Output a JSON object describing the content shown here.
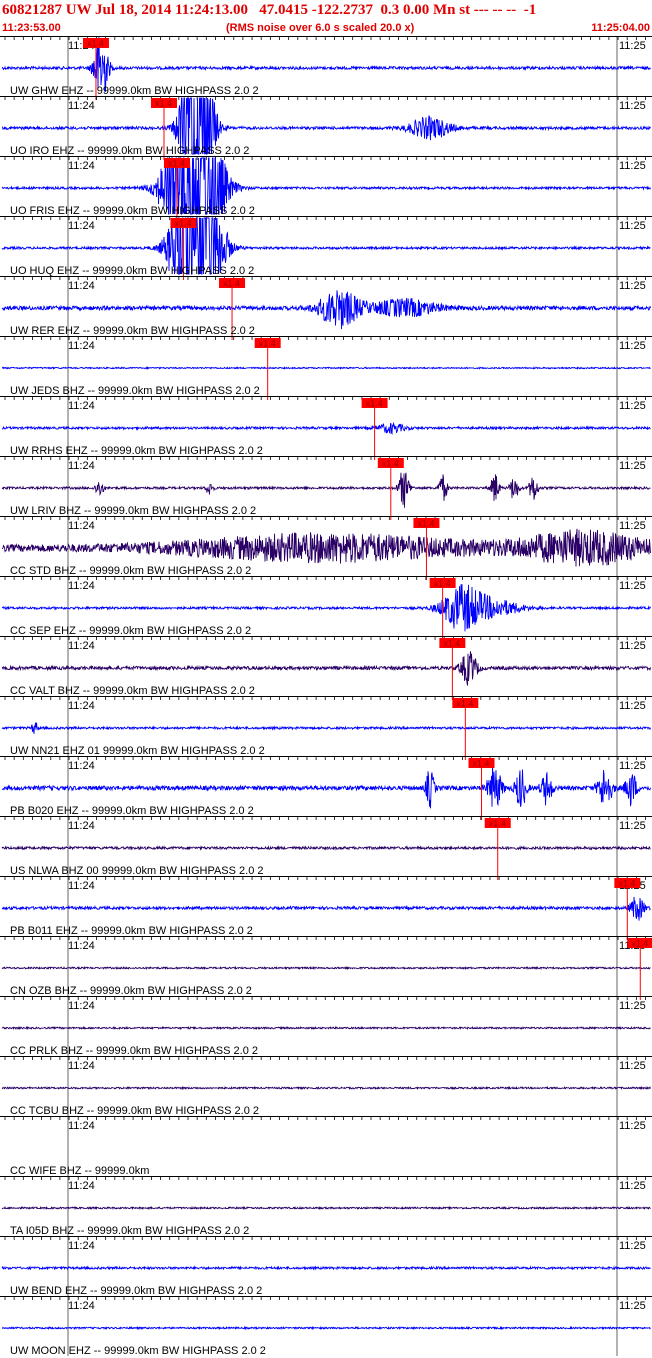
{
  "header": {
    "title": "60821287 UW Jul 18, 2014 11:24:13.00   47.0415 -122.2737  0.3 0.00 Mn st --- -- --  -1",
    "start_time": "11:23:53.00",
    "note": "(RMS noise over 6.0 s scaled 20.0 x)",
    "end_time": "11:25:04.00"
  },
  "colors": {
    "header_text": "#e00000",
    "trace_blue": "#0000ff",
    "trace_purple": "#2a0066",
    "pick": "#ff0000",
    "grid": "#000000"
  },
  "chart_data": {
    "type": "line",
    "title": "60821287 UW Jul 18, 2014 11:24:13.00   47.0415 -122.2737  0.3 0.00 Mn st --- -- --  -1",
    "x_tick_labels": [
      "11:24",
      "11:25"
    ],
    "pick_label": "x1.4",
    "traces": [
      {
        "label": "UW GHW EHZ -- 99999.0km BW  HIGHPASS  2.0  2",
        "color": "blue",
        "pick_time": 0.145,
        "bursts": [
          [
            0.152,
            0.01,
            3.0
          ]
        ],
        "noise": 0.1
      },
      {
        "label": "UO IRO EHZ -- 99999.0km BW  HIGHPASS  2.0  2",
        "color": "blue",
        "pick_time": 0.25,
        "bursts": [
          [
            0.3,
            0.02,
            12
          ],
          [
            0.66,
            0.03,
            0.8
          ]
        ],
        "noise": 0.1
      },
      {
        "label": "UO FRIS EHZ -- 99999.0km BW  HIGHPASS  2.0  2",
        "color": "blue",
        "pick_time": 0.27,
        "bursts": [
          [
            0.295,
            0.035,
            12
          ]
        ],
        "noise": 0.08
      },
      {
        "label": "UO HUQ EHZ -- 99999.0km BW  HIGHPASS  2.0  2",
        "color": "blue",
        "pick_time": 0.28,
        "bursts": [
          [
            0.3,
            0.03,
            12
          ]
        ],
        "noise": 0.08
      },
      {
        "label": "UW RER EHZ -- 99999.0km BW  HIGHPASS  2.0  2",
        "color": "blue",
        "pick_time": 0.355,
        "bursts": [
          [
            0.52,
            0.03,
            1.4
          ],
          [
            0.62,
            0.05,
            0.6
          ]
        ],
        "noise": 0.14
      },
      {
        "label": "UW JEDS BHZ -- 99999.0km BW  HIGHPASS  2.0  2",
        "color": "blue",
        "pick_time": 0.41,
        "bursts": [],
        "noise": 0.05
      },
      {
        "label": "UW RRHS EHZ -- 99999.0km BW  HIGHPASS  2.0  2",
        "color": "blue",
        "pick_time": 0.575,
        "bursts": [
          [
            0.6,
            0.02,
            0.35
          ]
        ],
        "noise": 0.08
      },
      {
        "label": "UW LRIV BHZ -- 99999.0km BW  HIGHPASS  2.0  2",
        "color": "purple",
        "pick_time": 0.6,
        "bursts": [
          [
            0.15,
            0.006,
            0.6
          ],
          [
            0.32,
            0.005,
            0.5
          ],
          [
            0.62,
            0.008,
            1.4
          ],
          [
            0.68,
            0.006,
            1.0
          ],
          [
            0.76,
            0.006,
            1.1
          ],
          [
            0.79,
            0.006,
            0.9
          ],
          [
            0.82,
            0.006,
            1.0
          ]
        ],
        "noise": 0.08
      },
      {
        "label": "CC STD BHZ -- 99999.0km BW  HIGHPASS  2.0  2",
        "color": "purple",
        "pick_time": 0.655,
        "bursts": [
          [
            0.5,
            0.22,
            0.9
          ],
          [
            0.9,
            0.1,
            1.1
          ]
        ],
        "noise": 0.25
      },
      {
        "label": "CC SEP EHZ -- 99999.0km BW  HIGHPASS  2.0  2",
        "color": "blue",
        "pick_time": 0.68,
        "bursts": [
          [
            0.71,
            0.03,
            1.6
          ],
          [
            0.76,
            0.04,
            0.6
          ]
        ],
        "noise": 0.08
      },
      {
        "label": "CC VALT BHZ -- 99999.0km BW  HIGHPASS  2.0  2",
        "color": "purple",
        "pick_time": 0.695,
        "bursts": [
          [
            0.72,
            0.012,
            1.2
          ]
        ],
        "noise": 0.12
      },
      {
        "label": "UW NN21 EHZ 01 99999.0km BW  HIGHPASS  2.0  2",
        "color": "blue",
        "pick_time": 0.715,
        "bursts": [
          [
            0.05,
            0.004,
            0.5
          ]
        ],
        "noise": 0.08
      },
      {
        "label": "PB B020 EHZ -- 99999.0km BW  HIGHPASS  2.0  2",
        "color": "blue",
        "pick_time": 0.74,
        "bursts": [
          [
            0.66,
            0.006,
            1.4
          ],
          [
            0.76,
            0.01,
            1.6
          ],
          [
            0.8,
            0.008,
            1.5
          ],
          [
            0.84,
            0.008,
            1.2
          ],
          [
            0.93,
            0.01,
            1.5
          ],
          [
            0.97,
            0.008,
            1.3
          ]
        ],
        "noise": 0.15
      },
      {
        "label": "US NLWA BHZ 00 99999.0km BW  HIGHPASS  2.0  2",
        "color": "purple",
        "pick_time": 0.765,
        "bursts": [],
        "noise": 0.09
      },
      {
        "label": "PB B011 EHZ -- 99999.0km BW  HIGHPASS  2.0  2",
        "color": "blue",
        "pick_time": 0.965,
        "bursts": [
          [
            0.98,
            0.01,
            0.9
          ]
        ],
        "noise": 0.1
      },
      {
        "label": "CN OZB BHZ -- 99999.0km BW  HIGHPASS  2.0  2",
        "color": "purple",
        "pick_time": 0.985,
        "bursts": [],
        "noise": 0.06
      },
      {
        "label": "CC PRLK BHZ -- 99999.0km BW  HIGHPASS  2.0  2",
        "color": "purple",
        "pick_time": null,
        "bursts": [],
        "noise": 0.06
      },
      {
        "label": "CC TCBU BHZ -- 99999.0km BW  HIGHPASS  2.0  2",
        "color": "purple",
        "pick_time": null,
        "bursts": [],
        "noise": 0.06
      },
      {
        "label": "CC WIFE BHZ -- 99999.0km",
        "color": "none",
        "pick_time": null,
        "bursts": [],
        "noise": 0
      },
      {
        "label": "TA I05D BHZ -- 99999.0km BW  HIGHPASS  2.0  2",
        "color": "purple",
        "pick_time": null,
        "bursts": [],
        "noise": 0.06
      },
      {
        "label": "UW BEND EHZ -- 99999.0km BW  HIGHPASS  2.0  2",
        "color": "blue",
        "pick_time": null,
        "bursts": [],
        "noise": 0.08
      },
      {
        "label": "UW MOON EHZ -- 99999.0km BW  HIGHPASS  2.0  2",
        "color": "blue",
        "pick_time": null,
        "bursts": [],
        "noise": 0.06
      }
    ]
  }
}
